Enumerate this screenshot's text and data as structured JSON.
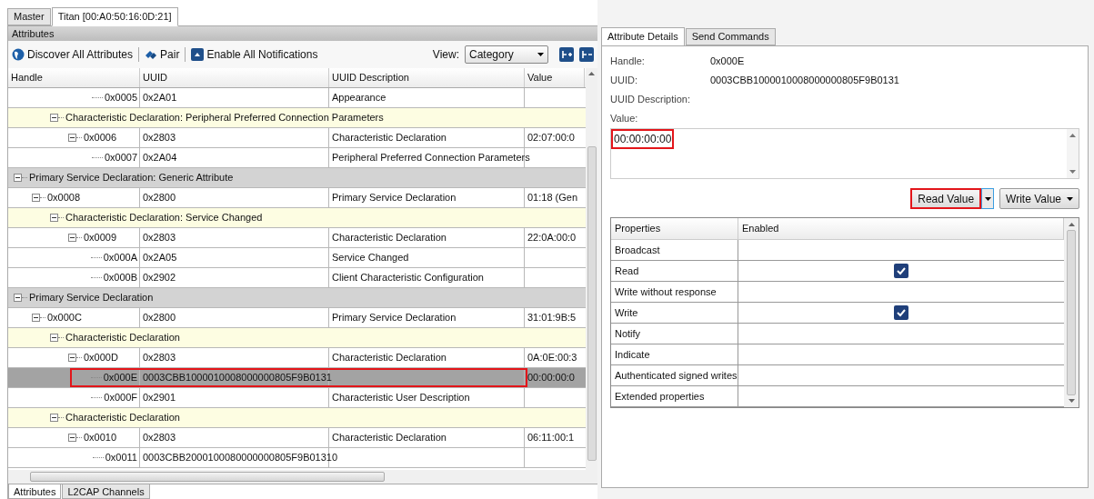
{
  "device_tabs": [
    {
      "label": "Master",
      "selected": false
    },
    {
      "label": "Titan [00:A0:50:16:0D:21]",
      "selected": true
    }
  ],
  "attributes_panel": {
    "title": "Attributes",
    "toolbar": {
      "discover": "Discover All Attributes",
      "pair": "Pair",
      "notifications": "Enable All Notifications",
      "view_label": "View:",
      "view_value": "Category"
    },
    "columns": [
      "Handle",
      "UUID",
      "UUID Description",
      "Value"
    ],
    "tree": [
      {
        "kind": "scrolled",
        "children": [
          {
            "kind": "scrolled",
            "children": [
              {
                "kind": "attribute",
                "handle": "0x0005",
                "uuid": "0x2A01",
                "description": "Appearance",
                "selected": false
              },
              {
                "kind": "characteristic",
                "label": "Characteristic Declaration: Peripheral Preferred Connection Parameters",
                "expanded": true,
                "children": [
                  {
                    "kind": "attribute",
                    "handle": "0x0006",
                    "uuid": "0x2803",
                    "description": "Characteristic Declaration",
                    "value": "02:07:00:0",
                    "selected": false,
                    "expanded": true,
                    "children": [
                      {
                        "kind": "attribute",
                        "handle": "0x0007",
                        "uuid": "0x2A04",
                        "description": "Peripheral Preferred Connection Parameters",
                        "selected": false
                      }
                    ]
                  }
                ]
              }
            ]
          }
        ]
      },
      {
        "kind": "service",
        "label": "Primary Service Declaration: Generic Attribute",
        "expanded": true,
        "children": [
          {
            "kind": "attribute",
            "handle": "0x0008",
            "uuid": "0x2800",
            "description": "Primary Service Declaration",
            "value": "01:18 (Gen",
            "selected": false,
            "expanded": true,
            "children": [
              {
                "kind": "characteristic",
                "label": "Characteristic Declaration: Service Changed",
                "expanded": true,
                "children": [
                  {
                    "kind": "attribute",
                    "handle": "0x0009",
                    "uuid": "0x2803",
                    "description": "Characteristic Declaration",
                    "value": "22:0A:00:0",
                    "selected": false,
                    "expanded": true,
                    "children": [
                      {
                        "kind": "attribute",
                        "handle": "0x000A",
                        "uuid": "0x2A05",
                        "description": "Service Changed",
                        "selected": false
                      },
                      {
                        "kind": "attribute",
                        "handle": "0x000B",
                        "uuid": "0x2902",
                        "description": "Client Characteristic Configuration",
                        "selected": false
                      }
                    ]
                  }
                ]
              }
            ]
          }
        ]
      },
      {
        "kind": "service",
        "label": "Primary Service Declaration",
        "expanded": true,
        "children": [
          {
            "kind": "attribute",
            "handle": "0x000C",
            "uuid": "0x2800",
            "description": "Primary Service Declaration",
            "value": "31:01:9B:5",
            "selected": false,
            "expanded": true,
            "children": [
              {
                "kind": "characteristic",
                "label": "Characteristic Declaration",
                "expanded": true,
                "children": [
                  {
                    "kind": "attribute",
                    "handle": "0x000D",
                    "uuid": "0x2803",
                    "description": "Characteristic Declaration",
                    "value": "0A:0E:00:3",
                    "selected": false,
                    "expanded": true,
                    "children": [
                      {
                        "kind": "attribute",
                        "handle": "0x000E",
                        "uuid": "0003CBB1000010008000000805F9B0131",
                        "value": "00:00:00:0",
                        "selected": true,
                        "highlighted": true
                      },
                      {
                        "kind": "attribute",
                        "handle": "0x000F",
                        "uuid": "0x2901",
                        "description": "Characteristic User Description",
                        "selected": false
                      }
                    ]
                  }
                ]
              },
              {
                "kind": "characteristic",
                "label": "Characteristic Declaration",
                "expanded": true,
                "children": [
                  {
                    "kind": "attribute",
                    "handle": "0x0010",
                    "uuid": "0x2803",
                    "description": "Characteristic Declaration",
                    "value": "06:11:00:1",
                    "selected": false,
                    "expanded": true,
                    "children": [
                      {
                        "kind": "attribute",
                        "handle": "0x0011",
                        "uuid": "0003CBB2000100080000000805F9B01310",
                        "selected": false
                      }
                    ]
                  }
                ]
              }
            ]
          }
        ]
      }
    ]
  },
  "bottom_tabs": [
    {
      "label": "Attributes",
      "selected": true
    },
    {
      "label": "L2CAP Channels",
      "selected": false
    }
  ],
  "details_tabs": [
    {
      "label": "Attribute Details",
      "selected": true
    },
    {
      "label": "Send Commands",
      "selected": false
    }
  ],
  "details": {
    "fields": [
      {
        "label": "Handle:",
        "value": "0x000E"
      },
      {
        "label": "UUID:",
        "value": "0003CBB1000010008000000805F9B0131"
      },
      {
        "label": "UUID Description:"
      },
      {
        "label": "Value:"
      }
    ],
    "value": "00:00:00:00",
    "value_highlighted": true,
    "read_button": {
      "label": "Read Value",
      "highlighted": true
    },
    "write_button": {
      "label": "Write Value",
      "highlighted": false
    }
  },
  "properties": {
    "columns": [
      "Properties",
      "Enabled"
    ],
    "rows": [
      {
        "name": "Broadcast",
        "checked": false
      },
      {
        "name": "Read",
        "checked": true
      },
      {
        "name": "Write without response",
        "checked": false
      },
      {
        "name": "Write",
        "checked": true
      },
      {
        "name": "Notify",
        "checked": false
      },
      {
        "name": "Indicate",
        "checked": false
      },
      {
        "name": "Authenticated signed writes",
        "checked": false
      },
      {
        "name": "Extended properties",
        "checked": false
      }
    ]
  }
}
